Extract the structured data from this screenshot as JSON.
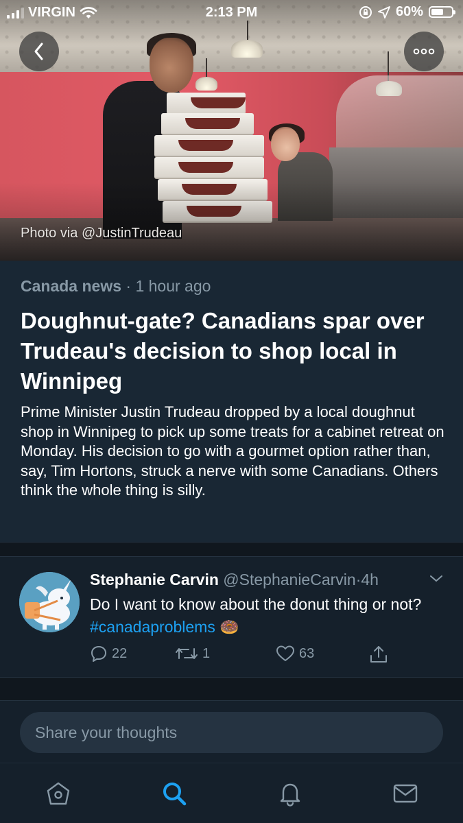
{
  "status_bar": {
    "carrier": "VIRGIN",
    "time": "2:13 PM",
    "battery_percent": "60%",
    "battery_level": 0.6
  },
  "hero": {
    "caption": "Photo via @JustinTrudeau"
  },
  "top_buttons": {
    "back_icon": "chevron-left-icon",
    "more_icon": "more-dots-icon"
  },
  "article": {
    "source": "Canada news",
    "separator": "·",
    "time_ago": "1 hour ago",
    "headline": "Doughnut-gate? Canadians spar over Trudeau's decision to shop local in Winnipeg",
    "summary": "Prime Minister Justin Trudeau dropped by a local doughnut shop in Winnipeg to pick up some treats for a cabinet retreat on Monday. His decision to go with a gourmet option rather than, say, Tim Hortons, struck a nerve with some Canadians. Others think the whole thing is silly."
  },
  "tweet": {
    "name": "Stephanie Carvin",
    "handle": "@StephanieCarvin",
    "separator": "·",
    "time": "4h",
    "text": "Do I want to know about the donut thing or not?",
    "hashtag": "#canadaproblems",
    "emoji": "🍩",
    "replies": "22",
    "retweets": "1",
    "likes": "63"
  },
  "composer": {
    "placeholder": "Share your thoughts"
  },
  "tabbar": {
    "items": [
      {
        "name": "home",
        "icon": "home-icon",
        "active": false
      },
      {
        "name": "search",
        "icon": "search-icon",
        "active": true
      },
      {
        "name": "notifications",
        "icon": "bell-icon",
        "active": false
      },
      {
        "name": "messages",
        "icon": "mail-icon",
        "active": false
      }
    ]
  },
  "colors": {
    "background": "#15202b",
    "card": "#192734",
    "accent": "#1da1f2",
    "secondary_text": "#8899a6"
  }
}
